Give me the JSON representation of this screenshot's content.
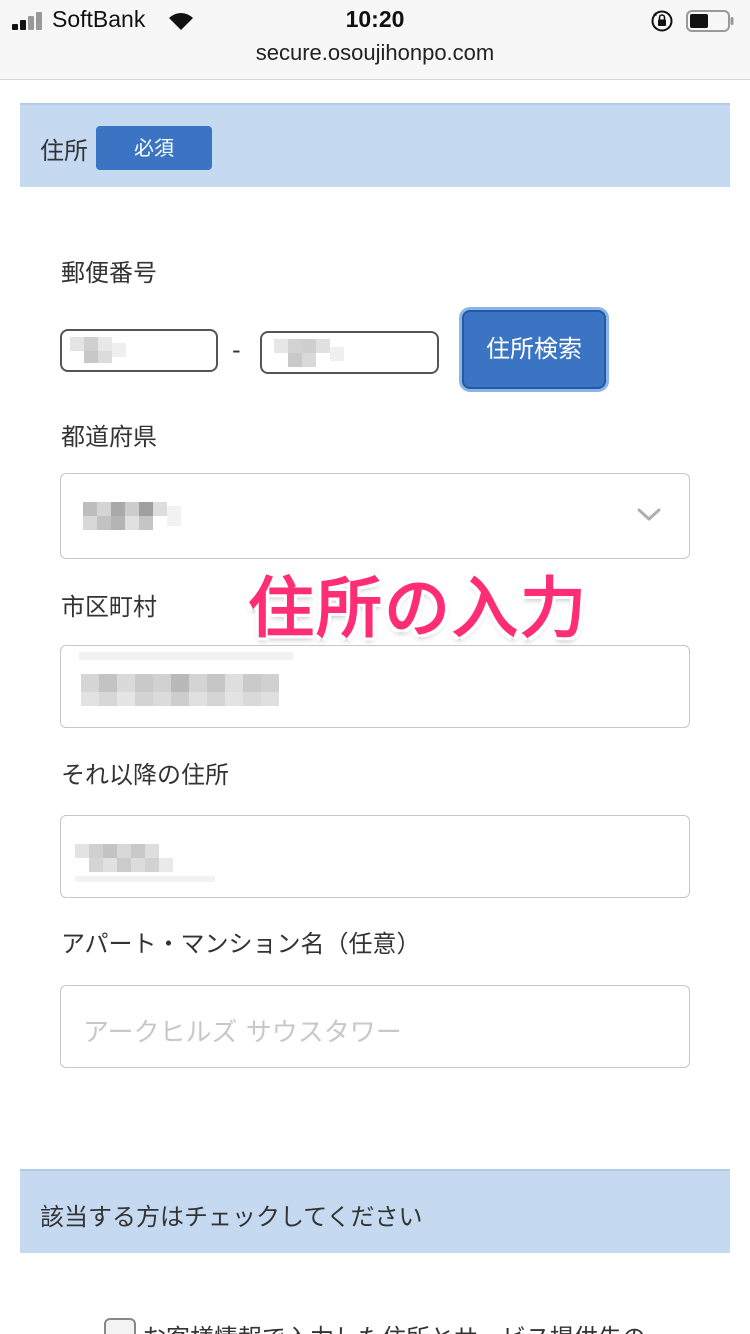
{
  "status_bar": {
    "carrier": "SoftBank",
    "time": "10:20",
    "url": "secure.osoujihonpo.com"
  },
  "address_section": {
    "title": "住所",
    "required_badge": "必須",
    "postal_code_label": "郵便番号",
    "postal_separator": "-",
    "search_button": "住所検索",
    "prefecture_label": "都道府県",
    "city_label": "市区町村",
    "street_label": "それ以降の住所",
    "building_label": "アパート・マンション名（任意）",
    "building_placeholder": "アークヒルズ サウスタワー"
  },
  "annotation": "住所の入力",
  "check_section": {
    "title": "該当する方はチェックしてください",
    "checkbox_label": "お客様情報で入力した住所とサービス提供先の"
  },
  "colors": {
    "section_band": "#c5d9f0",
    "accent_blue": "#3a74c3",
    "annotation_pink": "#ff2d75"
  }
}
